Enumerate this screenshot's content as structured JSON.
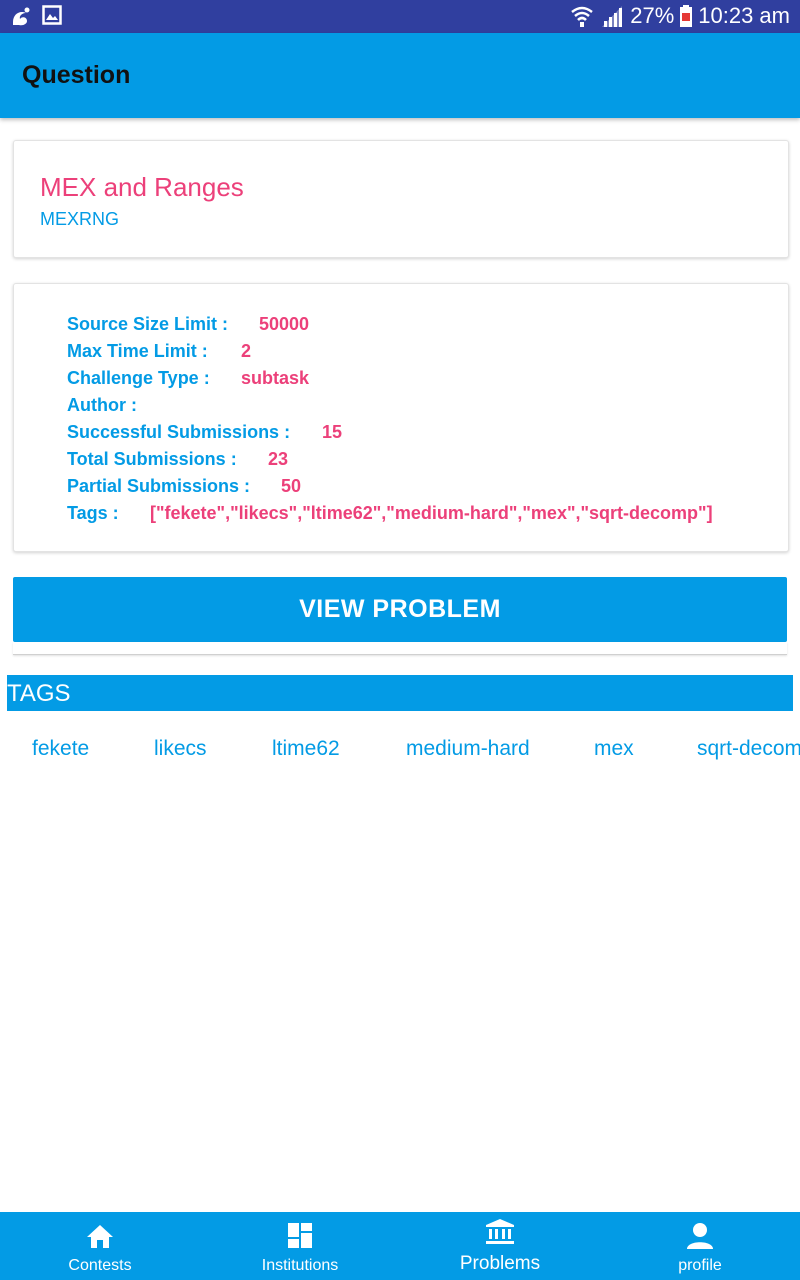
{
  "status_bar": {
    "battery": "27%",
    "time": "10:23 am",
    "icons": [
      "uc-browser-icon",
      "gallery-icon",
      "wifi-icon",
      "signal-icon",
      "battery-icon"
    ]
  },
  "app_bar": {
    "title": "Question"
  },
  "problem": {
    "name": "MEX and Ranges",
    "code": "MEXRNG"
  },
  "details": [
    {
      "label": "Source Size Limit :",
      "value": "50000"
    },
    {
      "label": "Max Time Limit :",
      "value": "2"
    },
    {
      "label": "Challenge Type :",
      "value": "subtask"
    },
    {
      "label": "Author :",
      "value": ""
    },
    {
      "label": "Successful Submissions :",
      "value": "15"
    },
    {
      "label": "Total Submissions :",
      "value": "23"
    },
    {
      "label": "Partial Submissions :",
      "value": "50"
    },
    {
      "label": "Tags :",
      "value": "[\"fekete\",\"likecs\",\"ltime62\",\"medium-hard\",\"mex\",\"sqrt-decomp\"]"
    }
  ],
  "view_button": "VIEW PROBLEM",
  "tags_header": "TAGS",
  "tags": [
    "fekete",
    "likecs",
    "ltime62",
    "medium-hard",
    "mex",
    "sqrt-decomp"
  ],
  "bottom_nav": [
    {
      "label": "Contests",
      "icon": "home-icon"
    },
    {
      "label": "Institutions",
      "icon": "dashboard-icon"
    },
    {
      "label": "Problems",
      "icon": "institution-icon",
      "active": true
    },
    {
      "label": "profile",
      "icon": "person-icon"
    }
  ],
  "colors": {
    "primary": "#039BE5",
    "accent": "#EC407A",
    "status_bar": "#303F9F"
  }
}
